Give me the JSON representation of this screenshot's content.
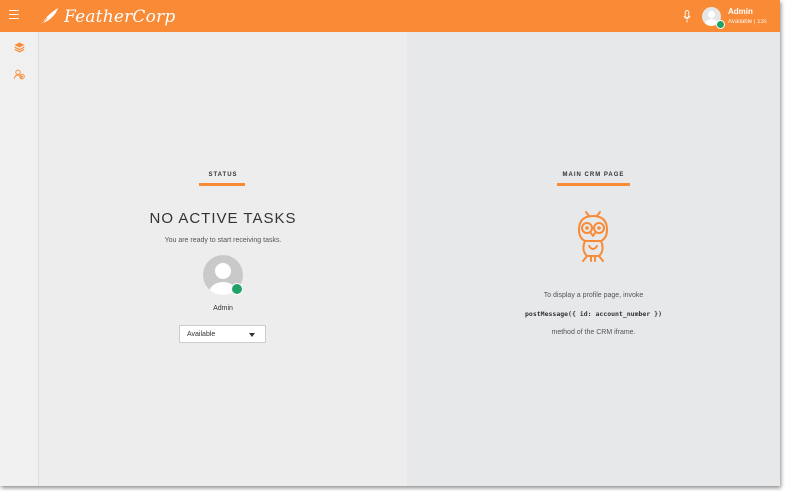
{
  "app": {
    "brand": "FeatherCorp"
  },
  "user": {
    "name": "Admin",
    "status": "Available | 13s"
  },
  "status_panel": {
    "title": "STATUS",
    "heading": "NO ACTIVE TASKS",
    "message": "You are ready to start receiving tasks.",
    "agent_name": "Admin",
    "selected_status": "Available"
  },
  "crm_panel": {
    "title": "MAIN CRM PAGE",
    "line1": "To display a profile page, invoke",
    "code": "postMessage({ id: account_number })",
    "line2": "method of the CRM iframe."
  },
  "colors": {
    "accent": "#f98a36",
    "online": "#21a366"
  }
}
